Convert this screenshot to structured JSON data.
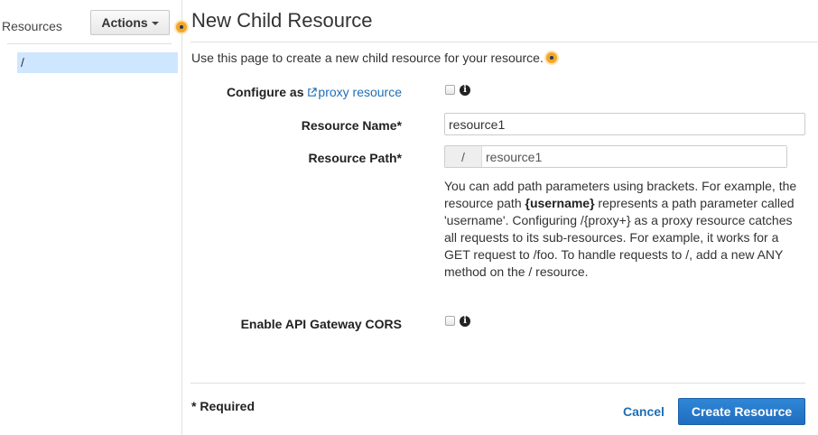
{
  "sidebar": {
    "title": "Resources",
    "actions_label": "Actions",
    "tree": [
      {
        "label": "/",
        "selected": true
      }
    ]
  },
  "main": {
    "title": "New Child Resource",
    "intro": "Use this page to create a new child resource for your resource.",
    "form": {
      "configure_proxy": {
        "label": "Configure as",
        "link": "proxy resource",
        "checked": false
      },
      "resource_name": {
        "label": "Resource Name*",
        "value": "resource1"
      },
      "resource_path": {
        "label": "Resource Path*",
        "prefix": "/",
        "value": "resource1"
      },
      "help": {
        "part1": "You can add path parameters using brackets. For example, the resource path ",
        "bold": "{username}",
        "part2": " represents a path parameter called 'username'. Configuring /{proxy+} as a proxy resource catches all requests to its sub-resources. For example, it works for a GET request to /foo. To handle requests to /, add a new ANY method on the / resource."
      },
      "enable_cors": {
        "label": "Enable API Gateway CORS",
        "checked": false
      }
    },
    "footer": {
      "required_note": "* Required",
      "cancel_label": "Cancel",
      "create_label": "Create Resource"
    }
  },
  "colors": {
    "accent": "#1f6eb4",
    "selected_row": "#cfe6ff",
    "primary_button": "#2379cc",
    "indicator": "#f5a623"
  },
  "icons": {
    "info": "info-circle-icon",
    "external_link": "external-link-icon",
    "caret": "caret-down-icon"
  }
}
